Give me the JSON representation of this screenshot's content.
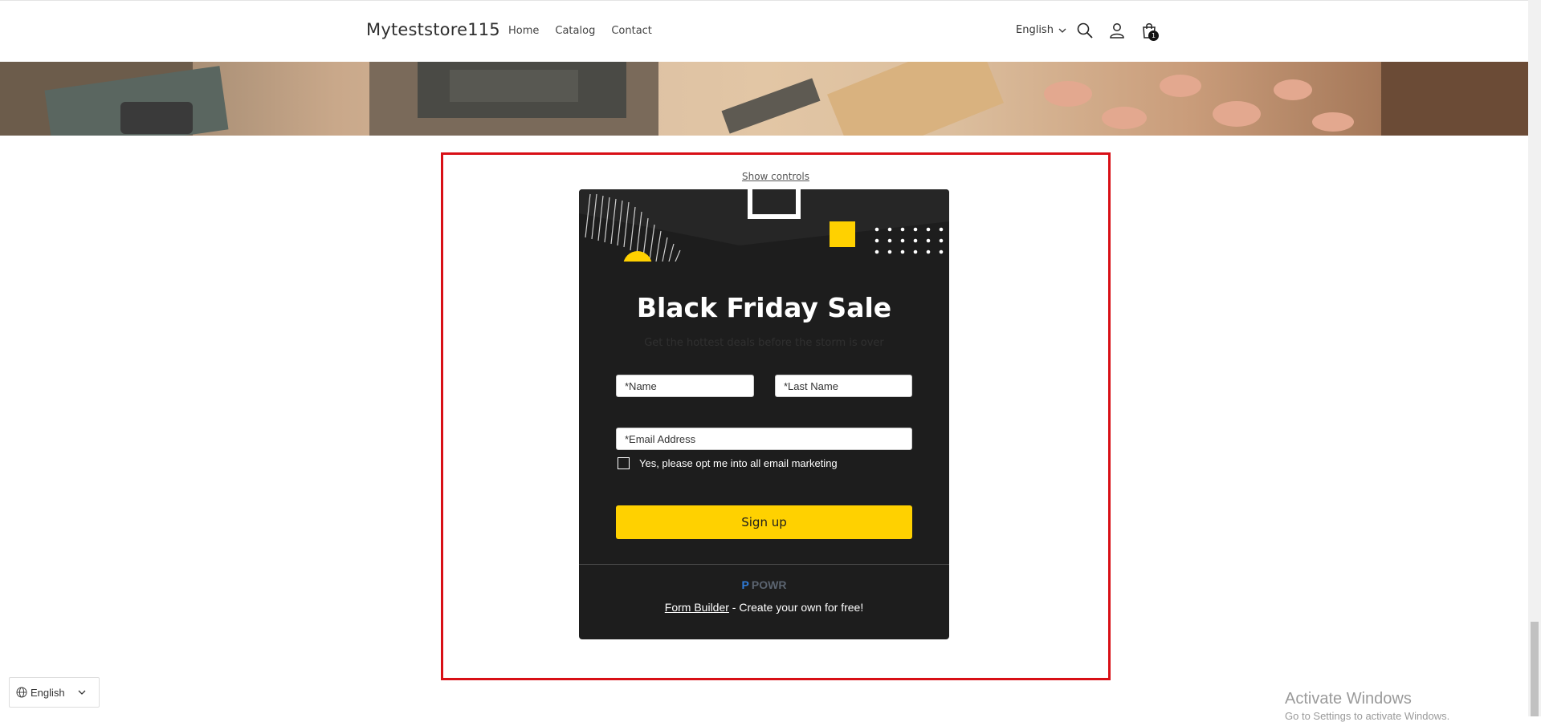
{
  "header": {
    "logo": "Myteststore115",
    "nav": [
      "Home",
      "Catalog",
      "Contact"
    ],
    "language": "English",
    "cart_count": "1"
  },
  "form": {
    "show_controls": "Show controls",
    "title": "Black Friday Sale",
    "subtitle": "Get the hottest deals before the storm is over",
    "first_name_placeholder": "*Name",
    "last_name_placeholder": "*Last Name",
    "email_placeholder": "*Email Address",
    "optin_label": "Yes, please opt me into all email marketing",
    "signup_label": "Sign up",
    "powr_logo": "P",
    "powr_label": "POWR",
    "builder_link": "Form Builder",
    "builder_suffix": " - Create your own for free!",
    "accent_color": "#ffd100",
    "card_color": "#1d1d1d"
  },
  "footer": {
    "language_widget": "English"
  },
  "watermark": {
    "line1": "Activate Windows",
    "line2": "Go to Settings to activate Windows."
  }
}
